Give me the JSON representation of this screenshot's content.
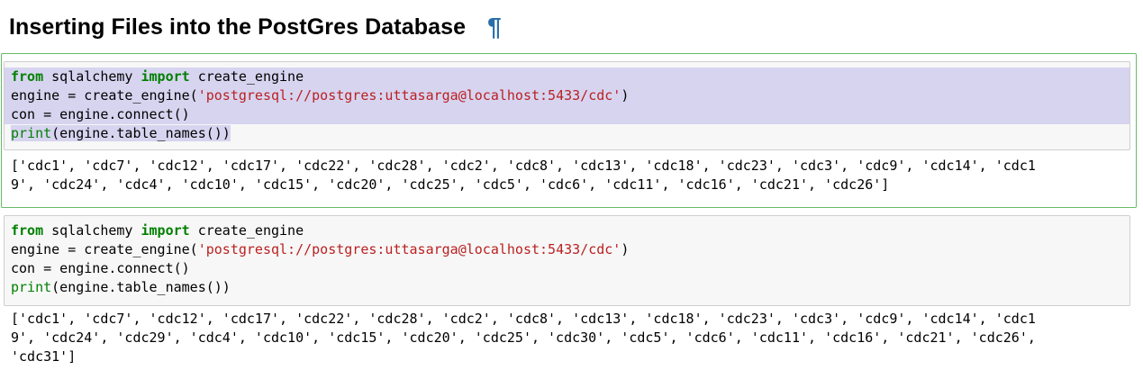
{
  "heading": {
    "title": "Inserting Files into the PostGres Database",
    "anchor_symbol": "¶"
  },
  "colors": {
    "selected_cell_border": "#66bb6a",
    "anchor": "#296eaa",
    "keyword": "#008000",
    "string": "#ba2121",
    "selection": "#d7d4f0"
  },
  "code": {
    "kw_from": "from",
    "module": " sqlalchemy ",
    "kw_import": "import",
    "import_name": " create_engine",
    "line2_prefix": "engine = create_engine(",
    "conn_string": "'postgresql://postgres:uttasarga@localhost:5433/cdc'",
    "line2_suffix": ")",
    "line3": "con = engine.connect()",
    "builtin_print": "print",
    "line4_rest": "(engine.table_names())"
  },
  "cells": [
    {
      "output_lines": [
        "['cdc1', 'cdc7', 'cdc12', 'cdc17', 'cdc22', 'cdc28', 'cdc2', 'cdc8', 'cdc13', 'cdc18', 'cdc23', 'cdc3', 'cdc9', 'cdc14', 'cdc1",
        "9', 'cdc24', 'cdc4', 'cdc10', 'cdc15', 'cdc20', 'cdc25', 'cdc5', 'cdc6', 'cdc11', 'cdc16', 'cdc21', 'cdc26']"
      ]
    },
    {
      "output_lines": [
        "['cdc1', 'cdc7', 'cdc12', 'cdc17', 'cdc22', 'cdc28', 'cdc2', 'cdc8', 'cdc13', 'cdc18', 'cdc23', 'cdc3', 'cdc9', 'cdc14', 'cdc1",
        "9', 'cdc24', 'cdc29', 'cdc4', 'cdc10', 'cdc15', 'cdc20', 'cdc25', 'cdc30', 'cdc5', 'cdc6', 'cdc11', 'cdc16', 'cdc21', 'cdc26',",
        "'cdc31']"
      ]
    }
  ]
}
